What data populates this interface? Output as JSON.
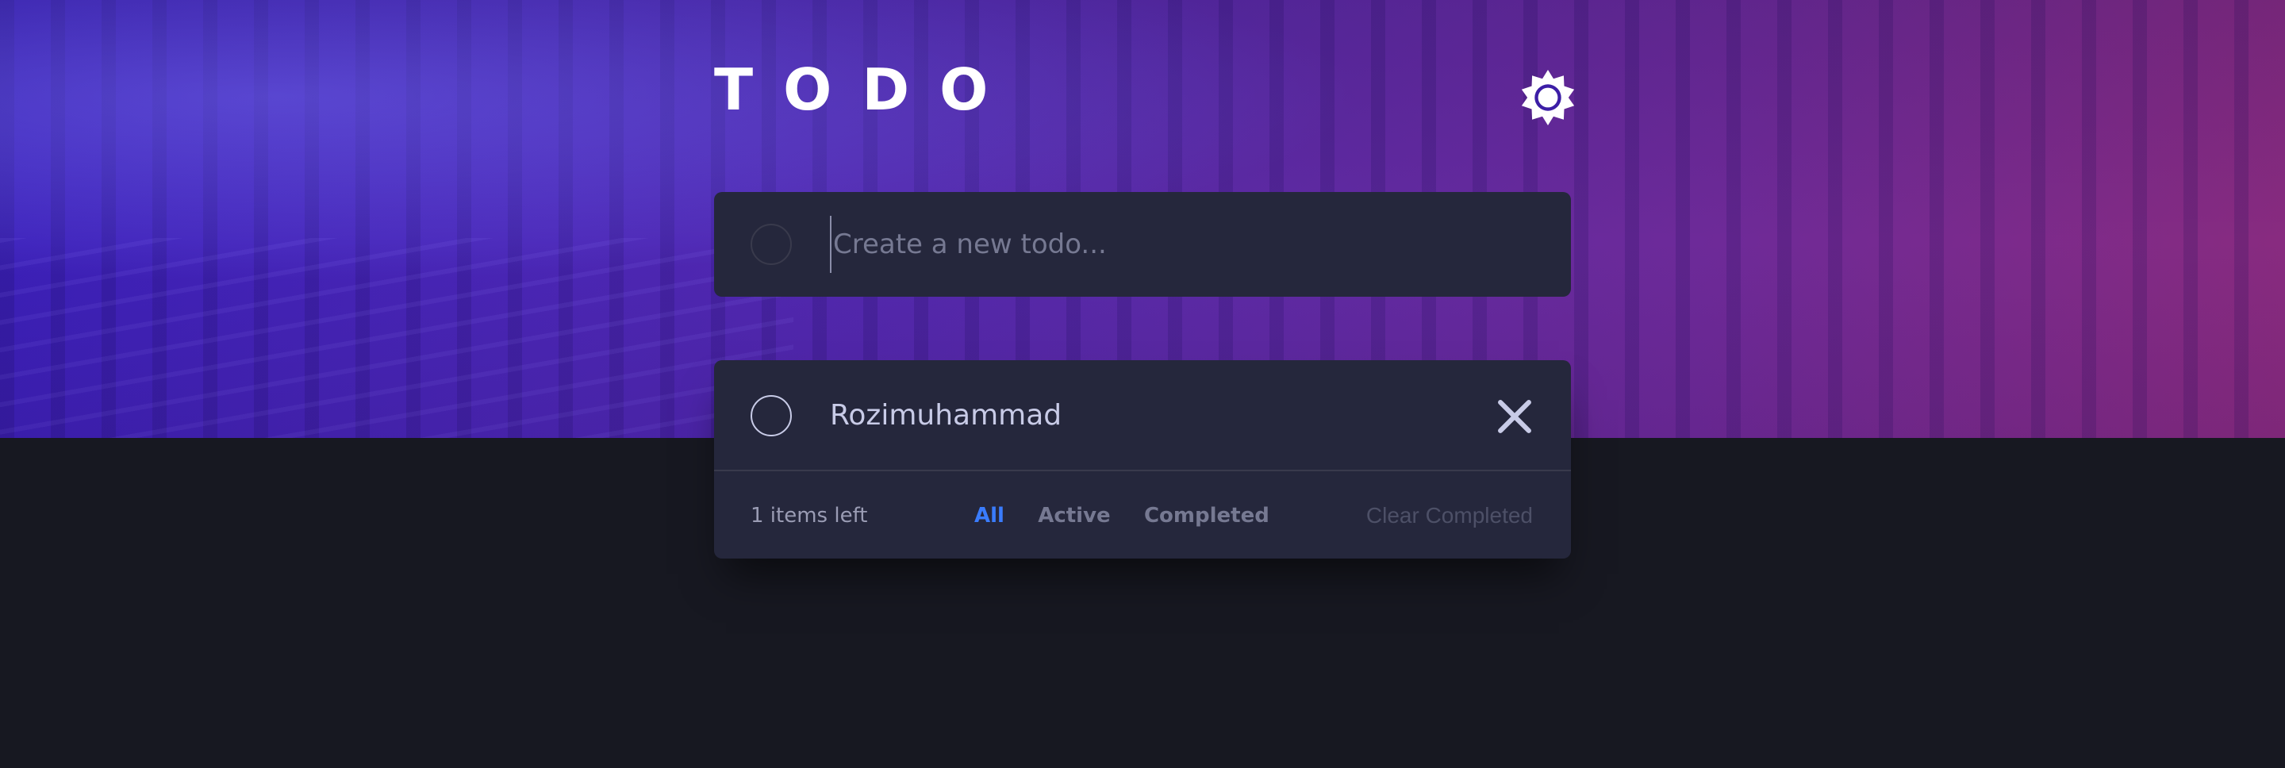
{
  "header": {
    "title": "TODO",
    "theme_toggle_icon": "sun-icon"
  },
  "new_todo": {
    "placeholder": "Create a new todo...",
    "value": ""
  },
  "todos": [
    {
      "text": "Rozimuhammad",
      "completed": false,
      "delete_icon": "close-icon"
    }
  ],
  "footer": {
    "items_left": "1 items left",
    "filters": [
      "All",
      "Active",
      "Completed"
    ],
    "active_filter": "All",
    "clear_label": "Clear Completed"
  },
  "colors": {
    "background": "#171821",
    "card": "#25273c",
    "text": "#c8cbe7",
    "accent": "#3a7cfd",
    "muted": "#767992",
    "hero_start": "#3a1fb8",
    "hero_end": "#8a2b7e"
  }
}
